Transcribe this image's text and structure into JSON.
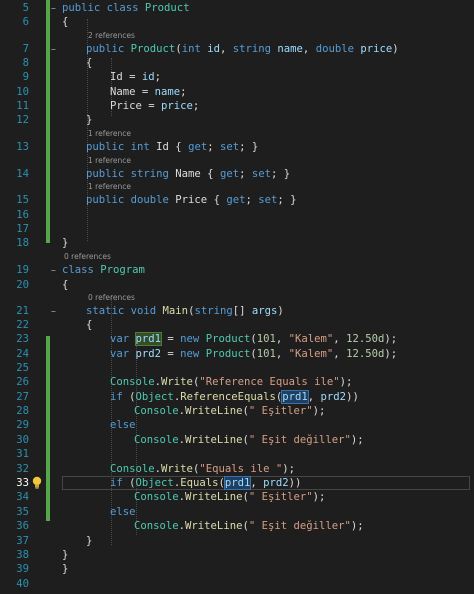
{
  "lines": [
    {
      "n": "5",
      "tokens": [
        [
          "kw",
          "public class "
        ],
        [
          "ty",
          "Product"
        ]
      ]
    },
    {
      "n": "6",
      "tokens": [
        [
          "p",
          "{"
        ]
      ]
    },
    {
      "n": "7",
      "lens": "2 references",
      "tokens": [
        [
          "kw",
          "public "
        ],
        [
          "ty",
          "Product"
        ],
        [
          "p",
          "("
        ],
        [
          "kw",
          "int "
        ],
        [
          "ident",
          "id"
        ],
        [
          "p",
          ", "
        ],
        [
          "kw",
          "string "
        ],
        [
          "ident",
          "name"
        ],
        [
          "p",
          ", "
        ],
        [
          "kw",
          "double "
        ],
        [
          "ident",
          "price"
        ],
        [
          "p",
          ")"
        ]
      ]
    },
    {
      "n": "8",
      "tokens": [
        [
          "p",
          "{"
        ]
      ]
    },
    {
      "n": "9",
      "tokens": [
        [
          "p",
          "Id = "
        ],
        [
          "ident",
          "id"
        ],
        [
          "p",
          ";"
        ]
      ]
    },
    {
      "n": "10",
      "tokens": [
        [
          "p",
          "Name = "
        ],
        [
          "ident",
          "name"
        ],
        [
          "p",
          ";"
        ]
      ]
    },
    {
      "n": "11",
      "tokens": [
        [
          "p",
          "Price = "
        ],
        [
          "ident",
          "price"
        ],
        [
          "p",
          ";"
        ]
      ]
    },
    {
      "n": "12",
      "tokens": [
        [
          "p",
          "}"
        ]
      ]
    },
    {
      "n": "13",
      "lens": "1 reference",
      "tokens": [
        [
          "kw",
          "public int "
        ],
        [
          "p",
          "Id { "
        ],
        [
          "kw",
          "get"
        ],
        [
          "p",
          "; "
        ],
        [
          "kw",
          "set"
        ],
        [
          "p",
          "; }"
        ]
      ]
    },
    {
      "n": "14",
      "lens": "1 reference",
      "tokens": [
        [
          "kw",
          "public string "
        ],
        [
          "p",
          "Name { "
        ],
        [
          "kw",
          "get"
        ],
        [
          "p",
          "; "
        ],
        [
          "kw",
          "set"
        ],
        [
          "p",
          "; }"
        ]
      ]
    },
    {
      "n": "15",
      "lens": "1 reference",
      "tokens": [
        [
          "kw",
          "public double "
        ],
        [
          "p",
          "Price { "
        ],
        [
          "kw",
          "get"
        ],
        [
          "p",
          "; "
        ],
        [
          "kw",
          "set"
        ],
        [
          "p",
          "; }"
        ]
      ]
    },
    {
      "n": "16",
      "tokens": []
    },
    {
      "n": "17",
      "tokens": []
    },
    {
      "n": "18",
      "tokens": [
        [
          "p",
          "}"
        ]
      ]
    },
    {
      "n": "19",
      "lens": "0 references",
      "tokens": [
        [
          "kw",
          "class "
        ],
        [
          "ty",
          "Program"
        ]
      ]
    },
    {
      "n": "20",
      "tokens": [
        [
          "p",
          "{"
        ]
      ]
    },
    {
      "n": "21",
      "lens": "0 references",
      "tokens": [
        [
          "kw",
          "static void "
        ],
        [
          "mth",
          "Main"
        ],
        [
          "p",
          "("
        ],
        [
          "kw",
          "string"
        ],
        [
          "p",
          "[] "
        ],
        [
          "ident",
          "args"
        ],
        [
          "p",
          ")"
        ]
      ]
    },
    {
      "n": "22",
      "tokens": [
        [
          "p",
          "{"
        ]
      ]
    },
    {
      "n": "23",
      "tokens": [
        [
          "kw",
          "var "
        ],
        [
          "hlv",
          "prd1"
        ],
        [
          "p",
          " = "
        ],
        [
          "kw",
          "new "
        ],
        [
          "ty",
          "Product"
        ],
        [
          "p",
          "("
        ],
        [
          "num",
          "101"
        ],
        [
          "p",
          ", "
        ],
        [
          "str",
          "\"Kalem\""
        ],
        [
          "p",
          ", "
        ],
        [
          "num",
          "12.50d"
        ],
        [
          "p",
          ");"
        ]
      ]
    },
    {
      "n": "24",
      "tokens": [
        [
          "kw",
          "var "
        ],
        [
          "ident",
          "prd2"
        ],
        [
          "p",
          " = "
        ],
        [
          "kw",
          "new "
        ],
        [
          "ty",
          "Product"
        ],
        [
          "p",
          "("
        ],
        [
          "num",
          "101"
        ],
        [
          "p",
          ", "
        ],
        [
          "str",
          "\"Kalem\""
        ],
        [
          "p",
          ", "
        ],
        [
          "num",
          "12.50d"
        ],
        [
          "p",
          ");"
        ]
      ]
    },
    {
      "n": "25",
      "tokens": []
    },
    {
      "n": "26",
      "tokens": [
        [
          "ty",
          "Console"
        ],
        [
          "p",
          "."
        ],
        [
          "mth",
          "Write"
        ],
        [
          "p",
          "("
        ],
        [
          "str",
          "\"Reference Equals ile\""
        ],
        [
          "p",
          ");"
        ]
      ]
    },
    {
      "n": "27",
      "tokens": [
        [
          "kw",
          "if "
        ],
        [
          "p",
          "("
        ],
        [
          "ty",
          "Object"
        ],
        [
          "p",
          "."
        ],
        [
          "mth",
          "ReferenceEquals"
        ],
        [
          "p",
          "("
        ],
        [
          "hlr",
          "prd1"
        ],
        [
          "p",
          ", "
        ],
        [
          "ident",
          "prd2"
        ],
        [
          "p",
          "))"
        ]
      ]
    },
    {
      "n": "28",
      "tokens": [
        [
          "ty",
          "Console"
        ],
        [
          "p",
          "."
        ],
        [
          "mth",
          "WriteLine"
        ],
        [
          "p",
          "("
        ],
        [
          "str",
          "\" Eşitler\""
        ],
        [
          "p",
          ");"
        ]
      ]
    },
    {
      "n": "29",
      "tokens": [
        [
          "kw",
          "else"
        ]
      ]
    },
    {
      "n": "30",
      "tokens": [
        [
          "ty",
          "Console"
        ],
        [
          "p",
          "."
        ],
        [
          "mth",
          "WriteLine"
        ],
        [
          "p",
          "("
        ],
        [
          "str",
          "\" Eşit değiller\""
        ],
        [
          "p",
          ");"
        ]
      ]
    },
    {
      "n": "31",
      "tokens": []
    },
    {
      "n": "32",
      "tokens": [
        [
          "ty",
          "Console"
        ],
        [
          "p",
          "."
        ],
        [
          "mth",
          "Write"
        ],
        [
          "p",
          "("
        ],
        [
          "str",
          "\"Equals ile \""
        ],
        [
          "p",
          ");"
        ]
      ]
    },
    {
      "n": "33",
      "tokens": [
        [
          "kw",
          "if "
        ],
        [
          "p",
          "("
        ],
        [
          "ty",
          "Object"
        ],
        [
          "p",
          "."
        ],
        [
          "mth",
          "Equals"
        ],
        [
          "p",
          "("
        ],
        [
          "hlr",
          "prd1"
        ],
        [
          "p",
          ", "
        ],
        [
          "ident",
          "prd2"
        ],
        [
          "p",
          "))"
        ]
      ]
    },
    {
      "n": "34",
      "tokens": [
        [
          "ty",
          "Console"
        ],
        [
          "p",
          "."
        ],
        [
          "mth",
          "WriteLine"
        ],
        [
          "p",
          "("
        ],
        [
          "str",
          "\" Eşitler\""
        ],
        [
          "p",
          ");"
        ]
      ]
    },
    {
      "n": "35",
      "tokens": [
        [
          "kw",
          "else"
        ]
      ]
    },
    {
      "n": "36",
      "tokens": [
        [
          "ty",
          "Console"
        ],
        [
          "p",
          "."
        ],
        [
          "mth",
          "WriteLine"
        ],
        [
          "p",
          "("
        ],
        [
          "str",
          "\" Eşit değiller\""
        ],
        [
          "p",
          ");"
        ]
      ]
    },
    {
      "n": "37",
      "tokens": [
        [
          "p",
          "}"
        ]
      ]
    },
    {
      "n": "38",
      "tokens": [
        [
          "p",
          "}"
        ]
      ]
    },
    {
      "n": "39",
      "tokens": [
        [
          "p",
          "}"
        ]
      ]
    },
    {
      "n": "40",
      "tokens": []
    }
  ],
  "current_line": "33",
  "icons": {
    "lightbulb": "lightbulb-icon",
    "fold": "collapse-icon"
  },
  "colors": {
    "background": "#1e1e1e",
    "keyword": "#569cd6",
    "type": "#4ec9b0",
    "string": "#d69d85",
    "number": "#b5cea8",
    "method": "#dcdcaa",
    "identifier": "#9cdcfe",
    "line_number": "#2b91af",
    "change_bar": "#57a64a"
  }
}
